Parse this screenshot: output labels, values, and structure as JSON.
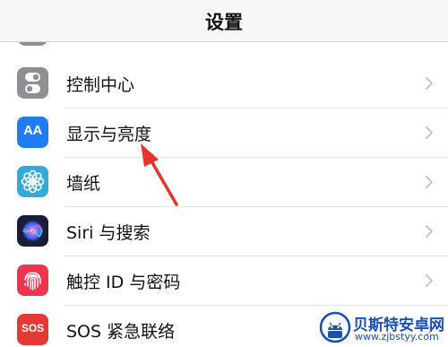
{
  "nav": {
    "title": "设置"
  },
  "rows": [
    {
      "label": "控制中心",
      "icon": "control-center-icon",
      "icon_color": "#8e8e93"
    },
    {
      "label": "显示与亮度",
      "icon": "display-brightness-icon",
      "icon_color": "#1f7cf5"
    },
    {
      "label": "墙纸",
      "icon": "wallpaper-icon",
      "icon_color": "#33aadc"
    },
    {
      "label": "Siri 与搜索",
      "icon": "siri-icon",
      "icon_color": "#1b1b3a"
    },
    {
      "label": "触控 ID 与密码",
      "icon": "touch-id-icon",
      "icon_color": "#f2334f"
    },
    {
      "label": "SOS 紧急联络",
      "icon": "sos-icon",
      "icon_color": "#e53935"
    }
  ],
  "icons": {
    "display_text": "AA",
    "sos_text": "SOS"
  },
  "annotation": {
    "arrow_color": "#e8332a"
  },
  "watermark": {
    "name": "贝斯特安卓网",
    "url": "www.zjbstyy.com"
  }
}
